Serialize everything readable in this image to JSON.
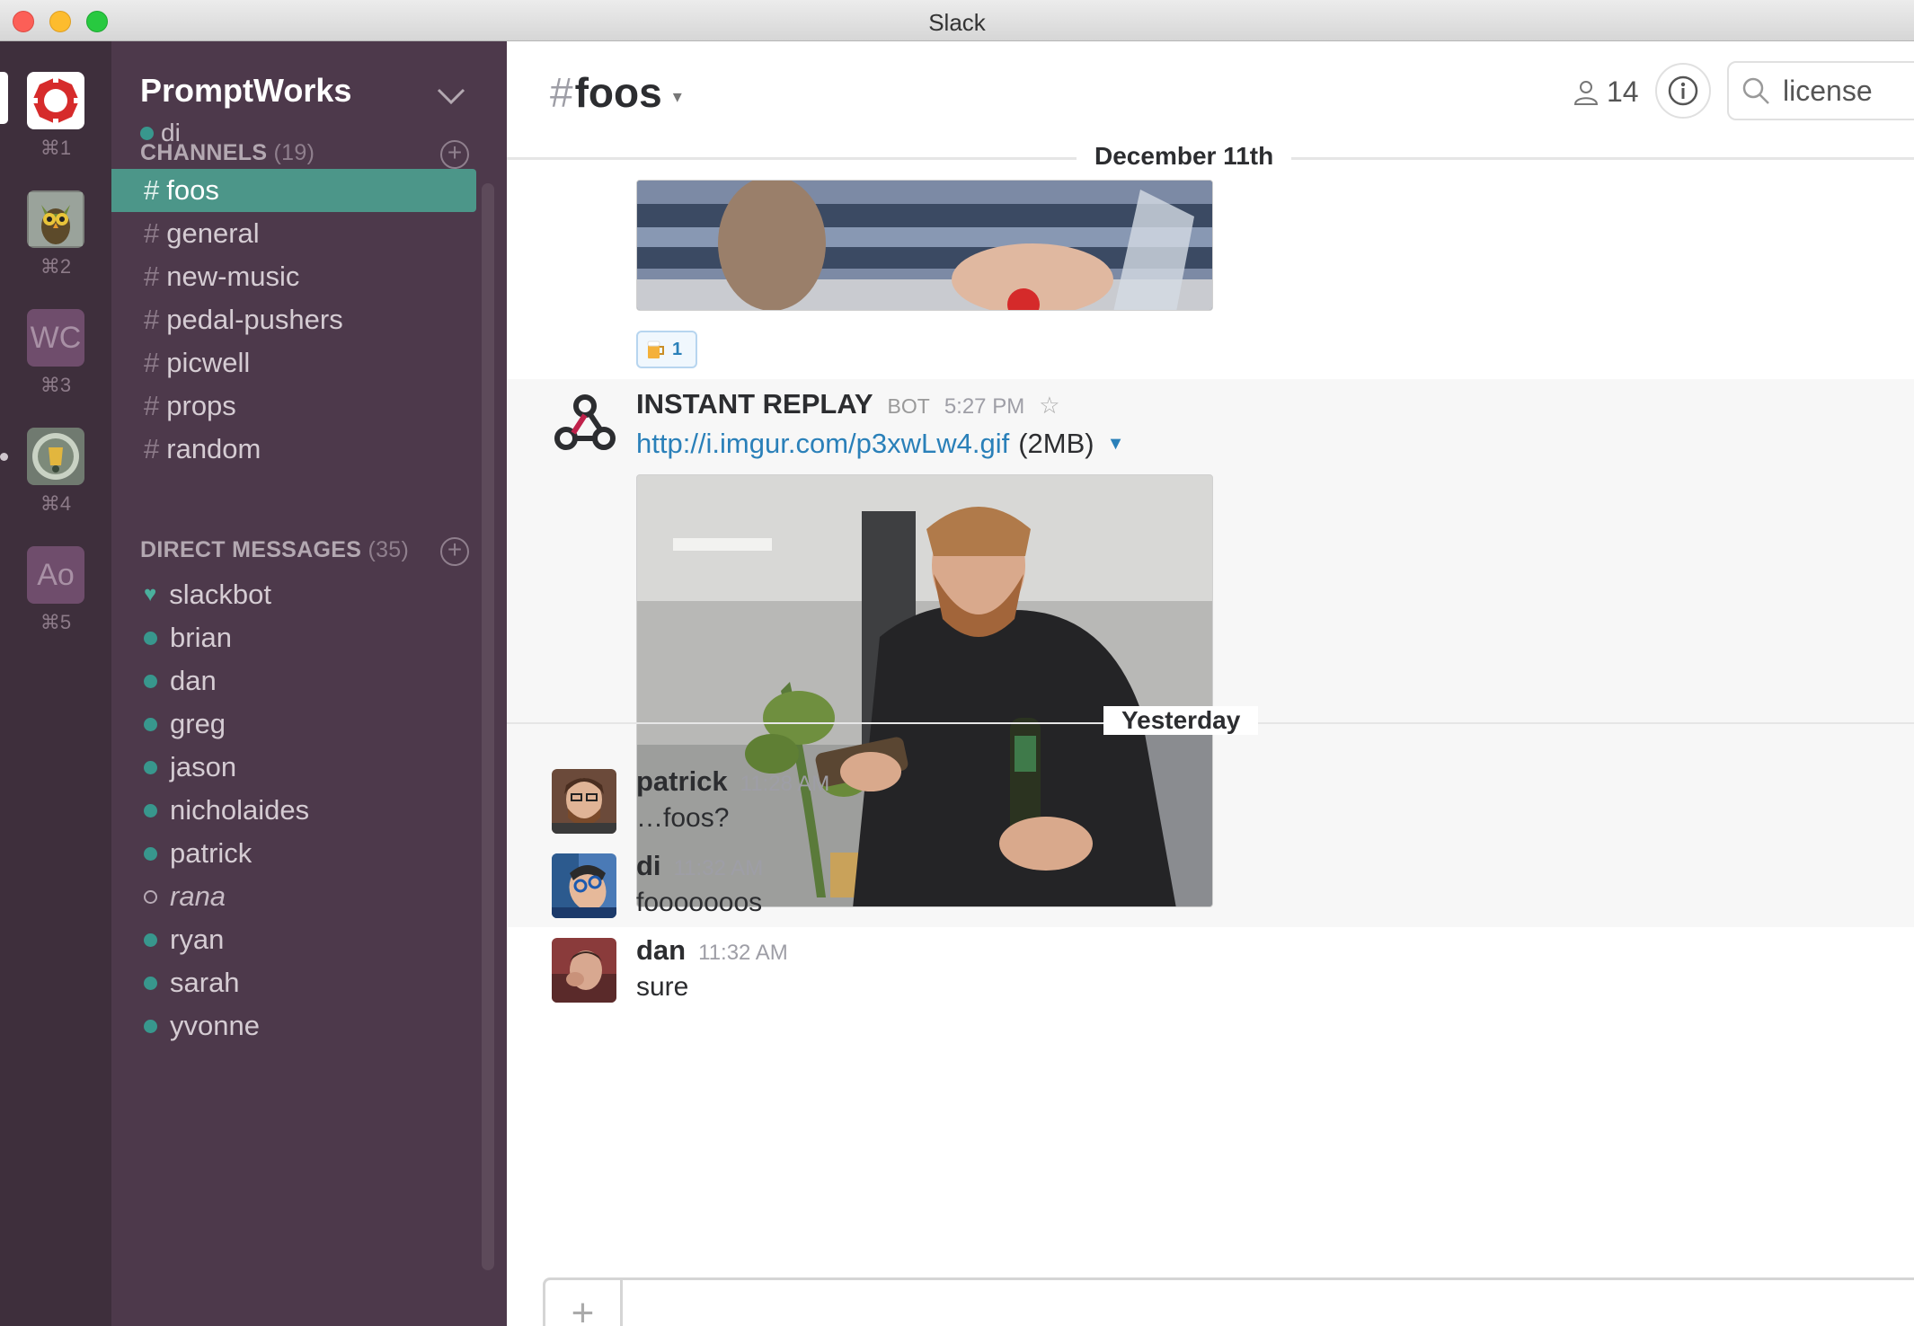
{
  "window": {
    "title": "Slack"
  },
  "teams": [
    {
      "key": "⌘1",
      "label": "",
      "icon": "promptworks-logo-icon"
    },
    {
      "key": "⌘2",
      "label": "",
      "icon": "owl-team-icon"
    },
    {
      "key": "⌘3",
      "label": "WC",
      "icon": "wc-team-icon"
    },
    {
      "key": "⌘4",
      "label": "",
      "icon": "badge-team-icon"
    },
    {
      "key": "⌘5",
      "label": "Ao",
      "icon": "ao-team-icon"
    }
  ],
  "sidebar": {
    "team_name": "PromptWorks",
    "user": "di",
    "channels_title": "CHANNELS",
    "channels_count": "(19)",
    "channels": [
      "foos",
      "general",
      "new-music",
      "pedal-pushers",
      "picwell",
      "props",
      "random"
    ],
    "active_channel": "foos",
    "dm_title": "DIRECT MESSAGES",
    "dm_count": "(35)",
    "dms": [
      {
        "name": "slackbot",
        "status": "heart"
      },
      {
        "name": "brian",
        "status": "online"
      },
      {
        "name": "dan",
        "status": "online"
      },
      {
        "name": "greg",
        "status": "online"
      },
      {
        "name": "jason",
        "status": "online"
      },
      {
        "name": "nicholaides",
        "status": "online"
      },
      {
        "name": "patrick",
        "status": "online"
      },
      {
        "name": "rana",
        "status": "away"
      },
      {
        "name": "ryan",
        "status": "online"
      },
      {
        "name": "sarah",
        "status": "online"
      },
      {
        "name": "yvonne",
        "status": "online"
      }
    ]
  },
  "header": {
    "channel": "foos",
    "member_count": "14",
    "search_value": "license"
  },
  "messages": {
    "divider_1": "December 11th",
    "reaction_count": "1",
    "bot": {
      "name": "INSTANT REPLAY",
      "badge": "BOT",
      "time": "5:27 PM",
      "link": "http://i.imgur.com/p3xwLw4.gif",
      "size": "(2MB)"
    },
    "divider_2": "Yesterday",
    "items": [
      {
        "sender": "patrick",
        "time": "11:28 AM",
        "text": "…foos?"
      },
      {
        "sender": "di",
        "time": "11:32 AM",
        "text": "fooooooos"
      },
      {
        "sender": "dan",
        "time": "11:32 AM",
        "text": "sure"
      }
    ]
  },
  "colors": {
    "sidebar_bg": "#4d394b",
    "teams_bg": "#3e2f3c",
    "active_channel": "#4c9689",
    "link": "#2a80b9",
    "presence": "#38978d"
  }
}
